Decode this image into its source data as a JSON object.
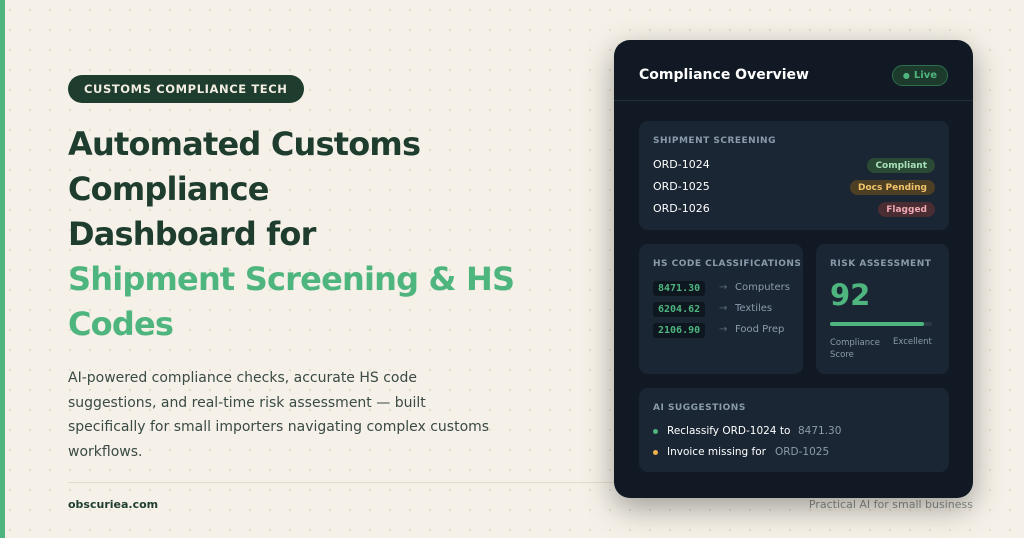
{
  "hero": {
    "eyebrow": "CUSTOMS COMPLIANCE TECH",
    "headline_dark": [
      "Automated Customs",
      "Compliance",
      "Dashboard for"
    ],
    "headline_accent": [
      "Shipment Screening & HS",
      "Codes"
    ],
    "description": "AI-powered compliance checks, accurate HS code suggestions, and real-time risk assessment — built specifically for small importers navigating complex customs workflows."
  },
  "footer": {
    "site": "obscuriea.com",
    "tagline": "Practical AI for small business"
  },
  "panel": {
    "title": "Compliance Overview",
    "live_label": "Live",
    "shipment_screening": {
      "label": "SHIPMENT SCREENING",
      "rows": [
        {
          "id": "ORD-1024",
          "status": "Compliant",
          "status_bg": "#2b4a36",
          "status_fg": "#a8e0b8"
        },
        {
          "id": "ORD-1025",
          "status": "Docs Pending",
          "status_bg": "#4d3f24",
          "status_fg": "#f2c36b"
        },
        {
          "id": "ORD-1026",
          "status": "Flagged",
          "status_bg": "#4a2c33",
          "status_fg": "#f0a8b4"
        }
      ]
    },
    "hs_codes": {
      "label": "HS CODE CLASSIFICATIONS",
      "rows": [
        {
          "code": "8471.30",
          "arrow": "→",
          "category": "Computers"
        },
        {
          "code": "6204.62",
          "arrow": "→",
          "category": "Textiles"
        },
        {
          "code": "2106.90",
          "arrow": "→",
          "category": "Food Prep"
        }
      ]
    },
    "risk": {
      "label": "RISK ASSESSMENT",
      "score": "92",
      "score_fraction": 0.92,
      "caption": "Compliance Score",
      "rating": "Excellent"
    },
    "suggestions": {
      "label": "AI SUGGESTIONS",
      "items": [
        {
          "text": "Reclassify ORD-1024 to",
          "ref": "8471.30",
          "dot": "#4fb57f"
        },
        {
          "text": "Invoice missing for",
          "ref": "ORD-1025",
          "dot": "#f2b14a"
        }
      ]
    }
  },
  "colors": {
    "background": "#f5f1e8",
    "brand_dark": "#1e3d2e",
    "accent_green": "#4fb57f",
    "panel_bg": "#111a24",
    "card_bg": "#1a2633"
  }
}
